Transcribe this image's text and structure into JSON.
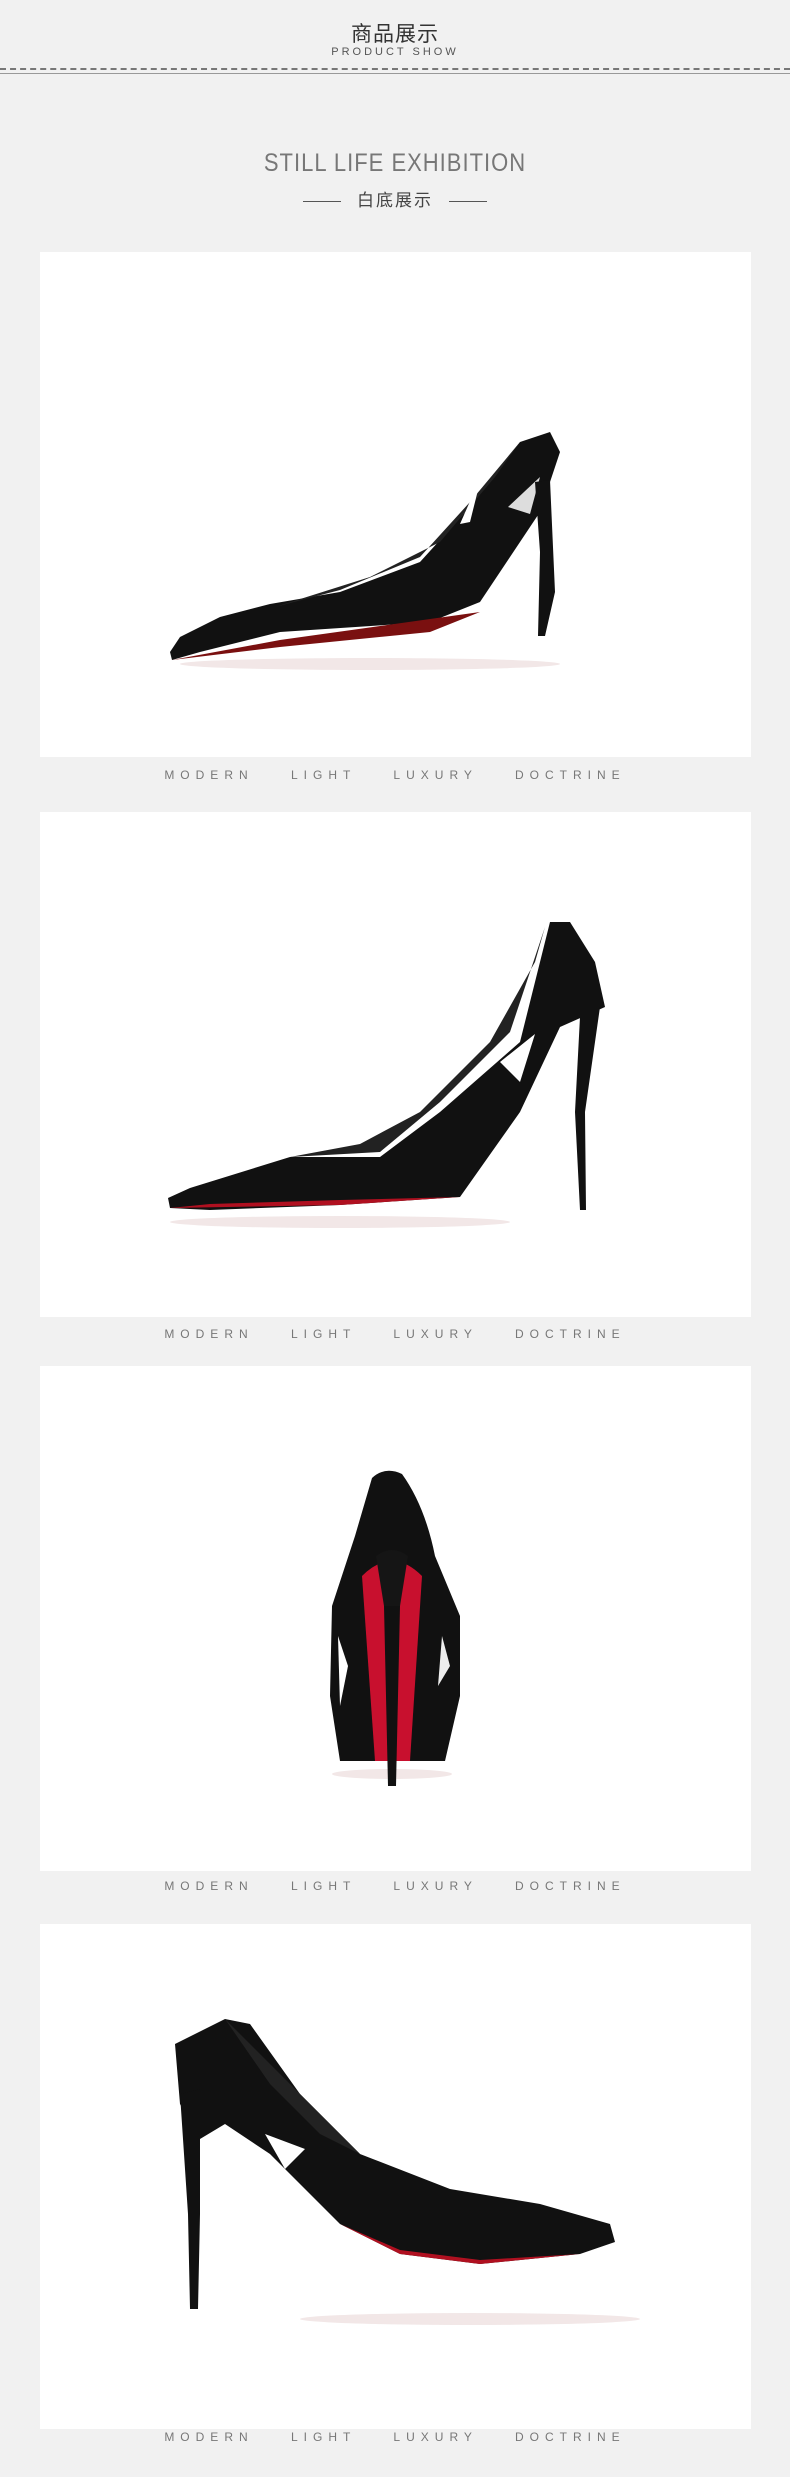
{
  "header": {
    "title": "商品展示",
    "subtitle": "PRODUCT SHOW"
  },
  "section": {
    "title": "STILL LIFE  EXHIBITION",
    "subtitle": "白底展示"
  },
  "gallery": [
    {
      "view": "side-view-left",
      "caption": "MODERN LIGHT LUXURY DOCTRINE"
    },
    {
      "view": "side-view-left-2",
      "caption": "MODERN LIGHT LUXURY DOCTRINE"
    },
    {
      "view": "back-view",
      "caption": "MODERN LIGHT LUXURY DOCTRINE"
    },
    {
      "view": "side-view-right",
      "caption": "MODERN LIGHT LUXURY DOCTRINE"
    }
  ],
  "colors": {
    "background": "#f1f1f1",
    "panel": "#ffffff",
    "shoe": "#111111",
    "sole": "#c8102e"
  }
}
